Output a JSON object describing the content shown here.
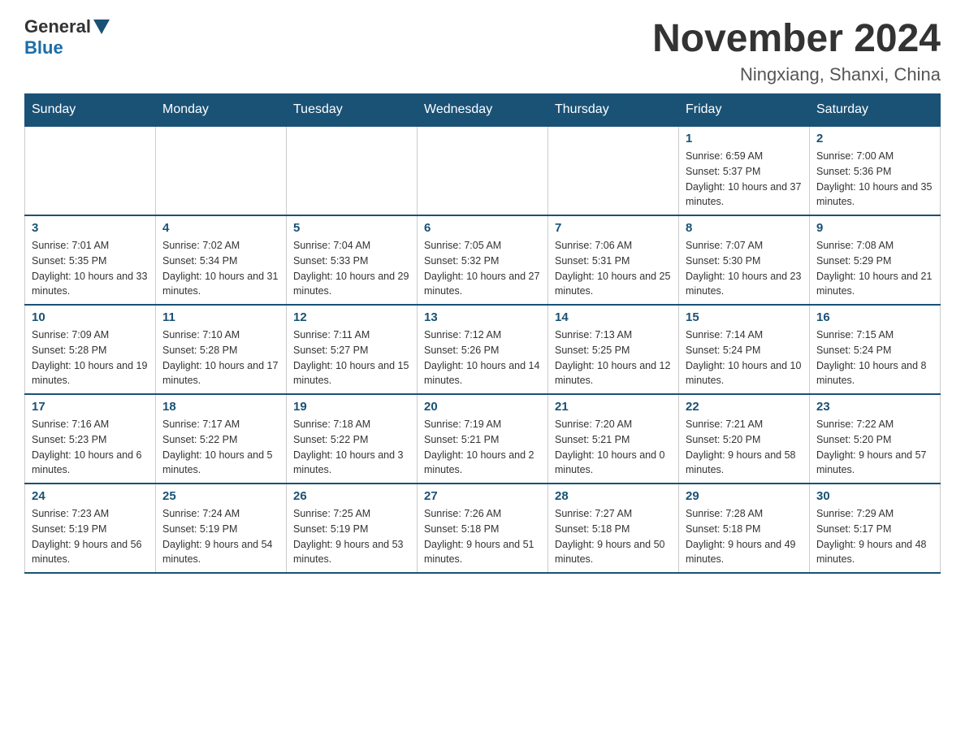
{
  "header": {
    "logo": {
      "general": "General",
      "blue": "Blue"
    },
    "title": "November 2024",
    "location": "Ningxiang, Shanxi, China"
  },
  "days_of_week": [
    "Sunday",
    "Monday",
    "Tuesday",
    "Wednesday",
    "Thursday",
    "Friday",
    "Saturday"
  ],
  "weeks": [
    [
      {
        "day": "",
        "sunrise": "",
        "sunset": "",
        "daylight": ""
      },
      {
        "day": "",
        "sunrise": "",
        "sunset": "",
        "daylight": ""
      },
      {
        "day": "",
        "sunrise": "",
        "sunset": "",
        "daylight": ""
      },
      {
        "day": "",
        "sunrise": "",
        "sunset": "",
        "daylight": ""
      },
      {
        "day": "",
        "sunrise": "",
        "sunset": "",
        "daylight": ""
      },
      {
        "day": "1",
        "sunrise": "Sunrise: 6:59 AM",
        "sunset": "Sunset: 5:37 PM",
        "daylight": "Daylight: 10 hours and 37 minutes."
      },
      {
        "day": "2",
        "sunrise": "Sunrise: 7:00 AM",
        "sunset": "Sunset: 5:36 PM",
        "daylight": "Daylight: 10 hours and 35 minutes."
      }
    ],
    [
      {
        "day": "3",
        "sunrise": "Sunrise: 7:01 AM",
        "sunset": "Sunset: 5:35 PM",
        "daylight": "Daylight: 10 hours and 33 minutes."
      },
      {
        "day": "4",
        "sunrise": "Sunrise: 7:02 AM",
        "sunset": "Sunset: 5:34 PM",
        "daylight": "Daylight: 10 hours and 31 minutes."
      },
      {
        "day": "5",
        "sunrise": "Sunrise: 7:04 AM",
        "sunset": "Sunset: 5:33 PM",
        "daylight": "Daylight: 10 hours and 29 minutes."
      },
      {
        "day": "6",
        "sunrise": "Sunrise: 7:05 AM",
        "sunset": "Sunset: 5:32 PM",
        "daylight": "Daylight: 10 hours and 27 minutes."
      },
      {
        "day": "7",
        "sunrise": "Sunrise: 7:06 AM",
        "sunset": "Sunset: 5:31 PM",
        "daylight": "Daylight: 10 hours and 25 minutes."
      },
      {
        "day": "8",
        "sunrise": "Sunrise: 7:07 AM",
        "sunset": "Sunset: 5:30 PM",
        "daylight": "Daylight: 10 hours and 23 minutes."
      },
      {
        "day": "9",
        "sunrise": "Sunrise: 7:08 AM",
        "sunset": "Sunset: 5:29 PM",
        "daylight": "Daylight: 10 hours and 21 minutes."
      }
    ],
    [
      {
        "day": "10",
        "sunrise": "Sunrise: 7:09 AM",
        "sunset": "Sunset: 5:28 PM",
        "daylight": "Daylight: 10 hours and 19 minutes."
      },
      {
        "day": "11",
        "sunrise": "Sunrise: 7:10 AM",
        "sunset": "Sunset: 5:28 PM",
        "daylight": "Daylight: 10 hours and 17 minutes."
      },
      {
        "day": "12",
        "sunrise": "Sunrise: 7:11 AM",
        "sunset": "Sunset: 5:27 PM",
        "daylight": "Daylight: 10 hours and 15 minutes."
      },
      {
        "day": "13",
        "sunrise": "Sunrise: 7:12 AM",
        "sunset": "Sunset: 5:26 PM",
        "daylight": "Daylight: 10 hours and 14 minutes."
      },
      {
        "day": "14",
        "sunrise": "Sunrise: 7:13 AM",
        "sunset": "Sunset: 5:25 PM",
        "daylight": "Daylight: 10 hours and 12 minutes."
      },
      {
        "day": "15",
        "sunrise": "Sunrise: 7:14 AM",
        "sunset": "Sunset: 5:24 PM",
        "daylight": "Daylight: 10 hours and 10 minutes."
      },
      {
        "day": "16",
        "sunrise": "Sunrise: 7:15 AM",
        "sunset": "Sunset: 5:24 PM",
        "daylight": "Daylight: 10 hours and 8 minutes."
      }
    ],
    [
      {
        "day": "17",
        "sunrise": "Sunrise: 7:16 AM",
        "sunset": "Sunset: 5:23 PM",
        "daylight": "Daylight: 10 hours and 6 minutes."
      },
      {
        "day": "18",
        "sunrise": "Sunrise: 7:17 AM",
        "sunset": "Sunset: 5:22 PM",
        "daylight": "Daylight: 10 hours and 5 minutes."
      },
      {
        "day": "19",
        "sunrise": "Sunrise: 7:18 AM",
        "sunset": "Sunset: 5:22 PM",
        "daylight": "Daylight: 10 hours and 3 minutes."
      },
      {
        "day": "20",
        "sunrise": "Sunrise: 7:19 AM",
        "sunset": "Sunset: 5:21 PM",
        "daylight": "Daylight: 10 hours and 2 minutes."
      },
      {
        "day": "21",
        "sunrise": "Sunrise: 7:20 AM",
        "sunset": "Sunset: 5:21 PM",
        "daylight": "Daylight: 10 hours and 0 minutes."
      },
      {
        "day": "22",
        "sunrise": "Sunrise: 7:21 AM",
        "sunset": "Sunset: 5:20 PM",
        "daylight": "Daylight: 9 hours and 58 minutes."
      },
      {
        "day": "23",
        "sunrise": "Sunrise: 7:22 AM",
        "sunset": "Sunset: 5:20 PM",
        "daylight": "Daylight: 9 hours and 57 minutes."
      }
    ],
    [
      {
        "day": "24",
        "sunrise": "Sunrise: 7:23 AM",
        "sunset": "Sunset: 5:19 PM",
        "daylight": "Daylight: 9 hours and 56 minutes."
      },
      {
        "day": "25",
        "sunrise": "Sunrise: 7:24 AM",
        "sunset": "Sunset: 5:19 PM",
        "daylight": "Daylight: 9 hours and 54 minutes."
      },
      {
        "day": "26",
        "sunrise": "Sunrise: 7:25 AM",
        "sunset": "Sunset: 5:19 PM",
        "daylight": "Daylight: 9 hours and 53 minutes."
      },
      {
        "day": "27",
        "sunrise": "Sunrise: 7:26 AM",
        "sunset": "Sunset: 5:18 PM",
        "daylight": "Daylight: 9 hours and 51 minutes."
      },
      {
        "day": "28",
        "sunrise": "Sunrise: 7:27 AM",
        "sunset": "Sunset: 5:18 PM",
        "daylight": "Daylight: 9 hours and 50 minutes."
      },
      {
        "day": "29",
        "sunrise": "Sunrise: 7:28 AM",
        "sunset": "Sunset: 5:18 PM",
        "daylight": "Daylight: 9 hours and 49 minutes."
      },
      {
        "day": "30",
        "sunrise": "Sunrise: 7:29 AM",
        "sunset": "Sunset: 5:17 PM",
        "daylight": "Daylight: 9 hours and 48 minutes."
      }
    ]
  ]
}
